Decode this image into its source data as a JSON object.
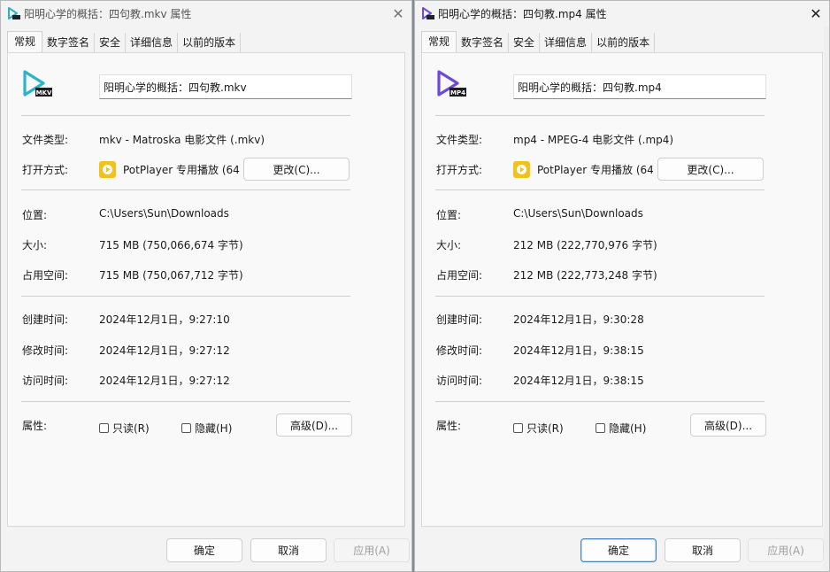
{
  "colors": {
    "mkv_icon": "#2bb4c9",
    "mp4_icon": "#6c4bd8",
    "potplayer": "#f2c21a",
    "focus_border": "#4a7fbf"
  },
  "tabs": [
    "常规",
    "数字签名",
    "安全",
    "详细信息",
    "以前的版本"
  ],
  "labels": {
    "file_type": "文件类型:",
    "open_with": "打开方式:",
    "location": "位置:",
    "size": "大小:",
    "size_on_disk": "占用空间:",
    "created": "创建时间:",
    "modified": "修改时间:",
    "accessed": "访问时间:",
    "attributes": "属性:",
    "change_btn": "更改(C)...",
    "readonly": "只读(R)",
    "hidden": "隐藏(H)",
    "advanced_btn": "高级(D)...",
    "ok": "确定",
    "cancel": "取消",
    "apply": "应用(A)"
  },
  "left": {
    "title": "阳明心学的概括：四句教.mkv 属性",
    "icon_badge": "MKV",
    "filename": "阳明心学的概括：四句教.mkv",
    "file_type": "mkv - Matroska 电影文件 (.mkv)",
    "open_with": "PotPlayer 专用播放 (64",
    "location": "C:\\Users\\Sun\\Downloads",
    "size": "715 MB (750,066,674 字节)",
    "size_on_disk": "715 MB (750,067,712 字节)",
    "created": "2024年12月1日，9:27:10",
    "modified": "2024年12月1日，9:27:12",
    "accessed": "2024年12月1日，9:27:12"
  },
  "right": {
    "title": "阳明心学的概括：四句教.mp4 属性",
    "icon_badge": "MP4",
    "filename": "阳明心学的概括：四句教.mp4",
    "file_type": "mp4 - MPEG-4 电影文件 (.mp4)",
    "open_with": "PotPlayer 专用播放 (64",
    "location": "C:\\Users\\Sun\\Downloads",
    "size": "212 MB (222,770,976 字节)",
    "size_on_disk": "212 MB (222,773,248 字节)",
    "created": "2024年12月1日，9:30:28",
    "modified": "2024年12月1日，9:38:15",
    "accessed": "2024年12月1日，9:38:15"
  }
}
